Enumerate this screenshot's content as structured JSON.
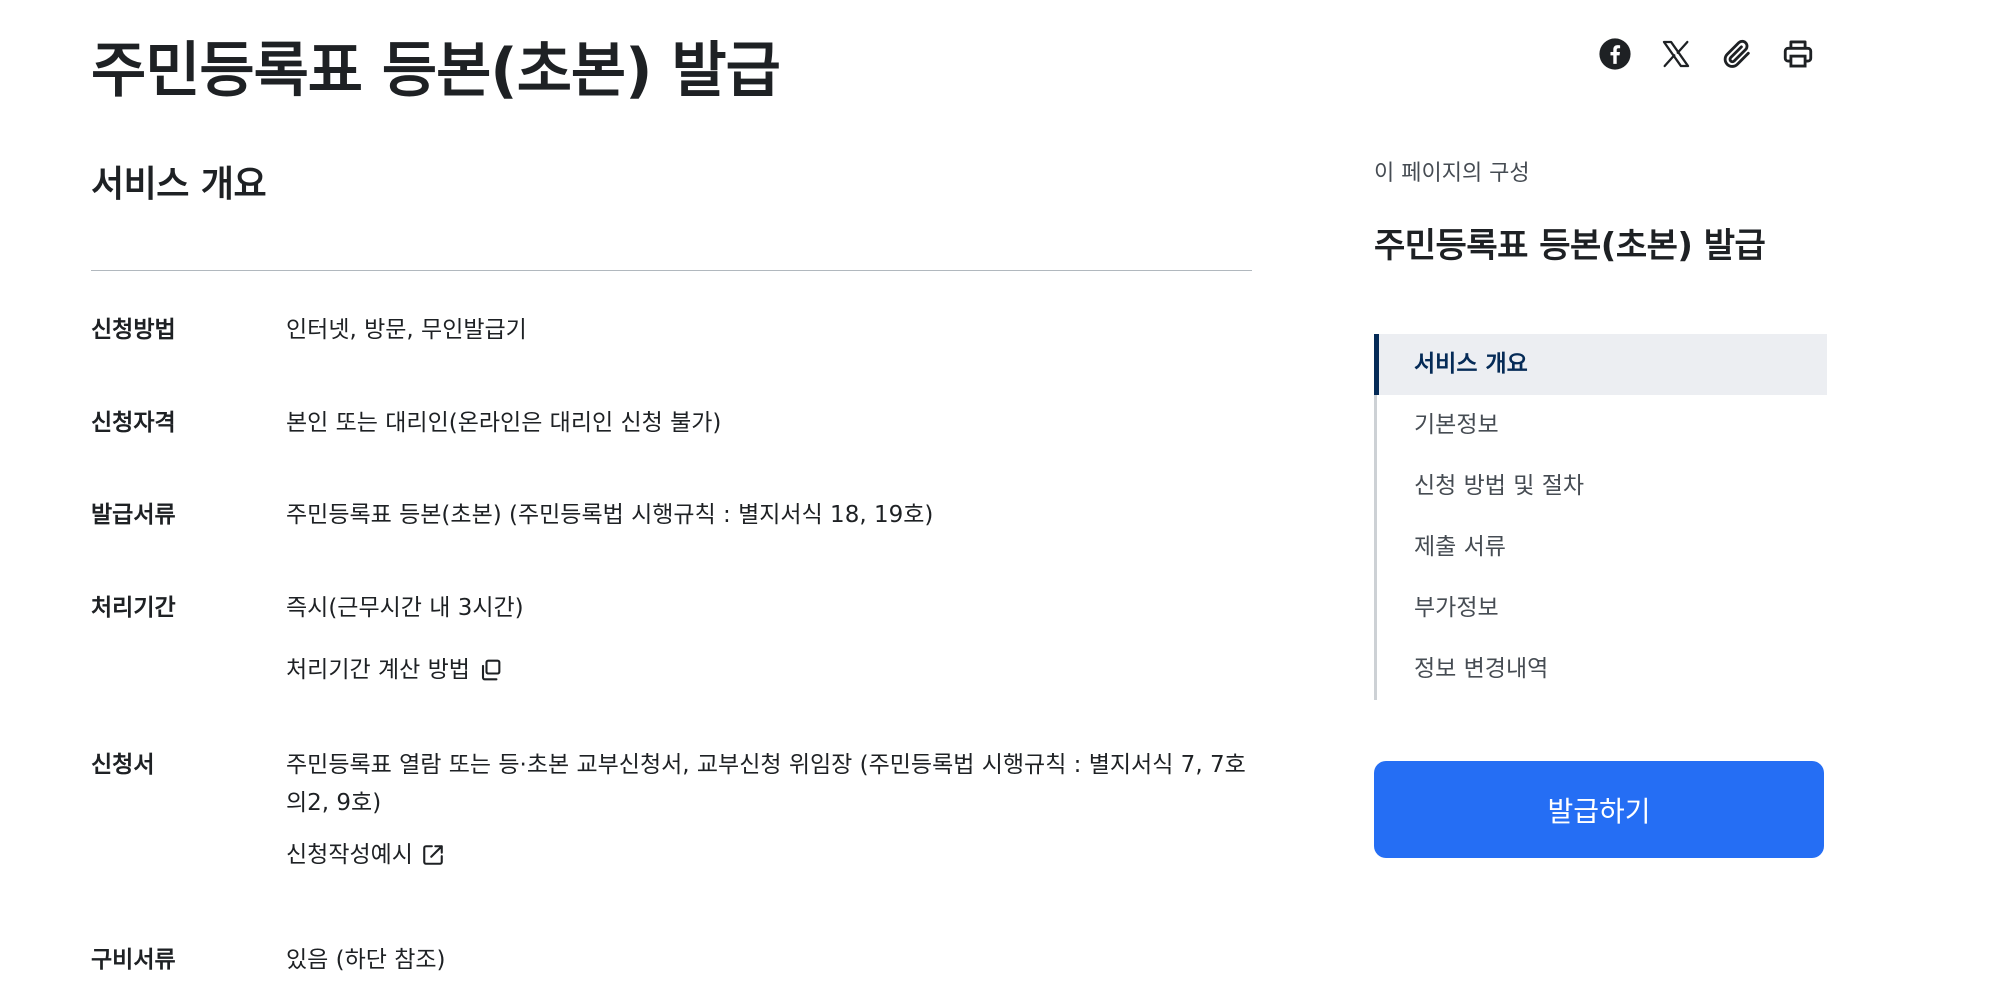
{
  "page": {
    "title": "주민등록표 등본(초본) 발급",
    "share_icons": [
      "facebook-icon",
      "x-icon",
      "paperclip-icon",
      "printer-icon"
    ]
  },
  "overview": {
    "section_title": "서비스 개요",
    "rows": [
      {
        "label": "신청방법",
        "lines": [
          "인터넷, 방문, 무인발급기"
        ]
      },
      {
        "label": "신청자격",
        "lines": [
          "본인 또는 대리인(온라인은 대리인 신청 불가)"
        ]
      },
      {
        "label": "발급서류",
        "lines": [
          "주민등록표 등본(초본) (주민등록법 시행규칙 : 별지서식 18, 19호)"
        ]
      },
      {
        "label": "처리기간",
        "lines": [
          "즉시(근무시간 내 3시간)"
        ],
        "link": "처리기간 계산 방법",
        "link_icon": "copy-window-icon"
      },
      {
        "label": "신청서",
        "lines": [
          "주민등록표 열람 또는 등·초본 교부신청서, 교부신청 위임장 (주민등록법 시행규칙 : 별지서식 7, 7호의2, 9호)"
        ],
        "link": "신청작성예시",
        "link_icon": "external-link-icon"
      },
      {
        "label": "구비서류",
        "lines": [
          "있음 (하단 참조)"
        ]
      }
    ]
  },
  "toc": {
    "caption": "이 페이지의 구성",
    "title": "주민등록표 등본(초본) 발급",
    "items": [
      "서비스 개요",
      "기본정보",
      "신청 방법 및 절차",
      "제출 서류",
      "부가정보",
      "정보 변경내역"
    ],
    "active_index": 0
  },
  "action": {
    "issue_label": "발급하기"
  },
  "colors": {
    "primary": "#256ef4",
    "toc_active": "#052b57",
    "toc_active_bg": "#eceef2",
    "text": "#1e2124"
  }
}
